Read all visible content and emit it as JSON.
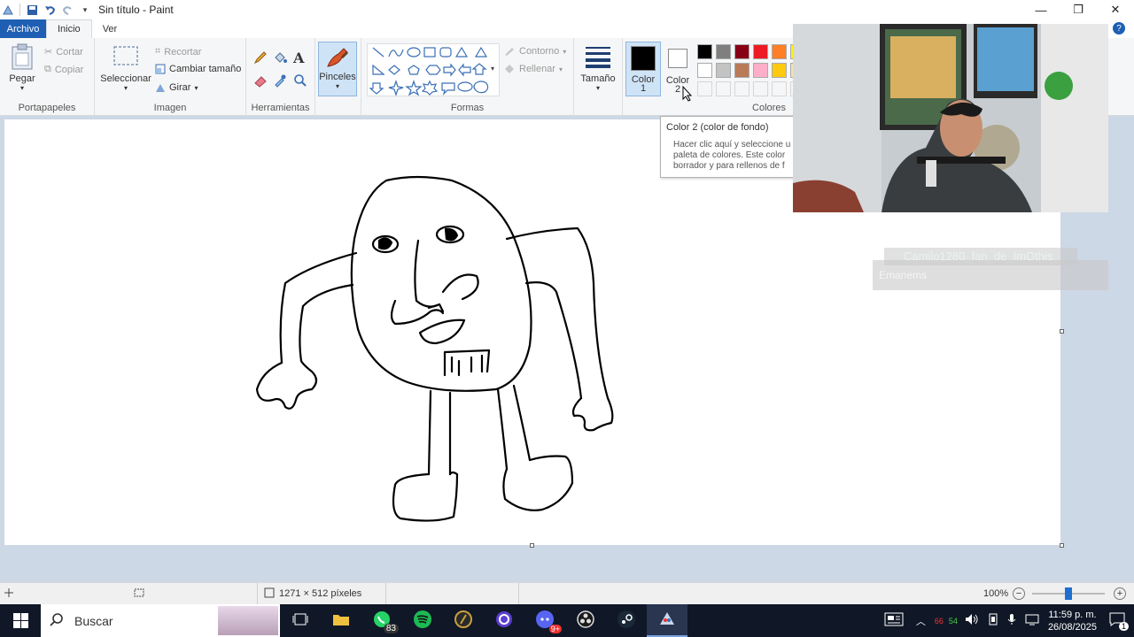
{
  "window": {
    "title": "Sin título - Paint",
    "controls": [
      "minimize-icon",
      "restore-icon",
      "close-icon"
    ]
  },
  "tabs": [
    {
      "label": "Archivo"
    },
    {
      "label": "Inicio"
    },
    {
      "label": "Ver"
    }
  ],
  "ribbon": {
    "portapapeles": {
      "label": "Portapapeles",
      "pegar": "Pegar",
      "cortar": "Cortar",
      "copiar": "Copiar"
    },
    "imagen": {
      "label": "Imagen",
      "seleccionar": "Seleccionar",
      "recortar": "Recortar",
      "cambiar_tamano": "Cambiar tamaño",
      "girar": "Girar"
    },
    "herramientas": {
      "label": "Herramientas"
    },
    "pinceles": {
      "label": "Pinceles"
    },
    "formas": {
      "label": "Formas",
      "contorno": "Contorno",
      "rellenar": "Rellenar"
    },
    "tamano": {
      "label": "Tamaño"
    },
    "colores": {
      "label": "Colores",
      "color1": "Color 1",
      "color1_line1": "Color",
      "color1_line2": "1",
      "color2_line1": "Color",
      "color2_line2": "2",
      "color1_value": "#000000",
      "color2_value": "#ffffff",
      "palette_row1": [
        "#000000",
        "#7f7f7f",
        "#880015",
        "#ed1c24",
        "#ff7f27",
        "#fff200"
      ],
      "palette_row2": [
        "#ffffff",
        "#c3c3c3",
        "#b97a57",
        "#ffaec9",
        "#ffc90e",
        "#efe4b0"
      ]
    }
  },
  "tooltip": {
    "title": "Color 2 (color de fondo)",
    "line1": "Hacer clic aquí y seleccione u",
    "line2": "paleta de colores. Este color",
    "line3": "borrador y para rellenos de f"
  },
  "chat": {
    "line1": "Camilo1280_fan_de_ImOthis",
    "line2": "Emanems"
  },
  "statusbar": {
    "dimensions": "1271 × 512 píxeles",
    "zoom": "100%",
    "zoom_fraction": 0.5
  },
  "taskbar": {
    "search": "Buscar",
    "whatsapp_badge": "83",
    "discord_badge": "9+",
    "time": "11:59 p. m.",
    "date": "26/08/2025",
    "notif_count": "1",
    "tray_a": "66",
    "tray_b": "54"
  },
  "colors": {
    "accent": "#1e5fb3",
    "ribbon_bg": "#f5f6f7",
    "workspace_bg": "#cdd8e6",
    "taskbar_bg": "#101827"
  }
}
